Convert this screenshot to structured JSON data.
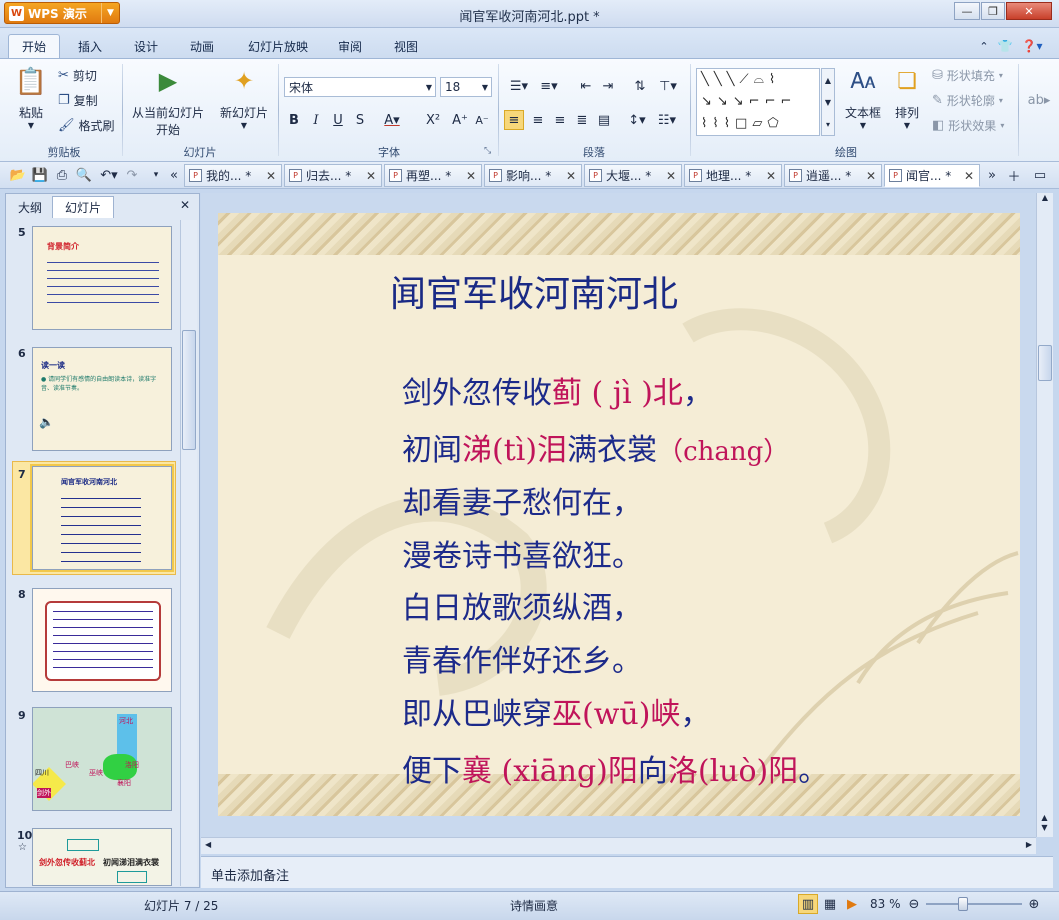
{
  "app": {
    "name": "WPS 演示"
  },
  "window": {
    "title": "闻官军收河南河北.ppt *"
  },
  "menu": {
    "tabs": [
      "开始",
      "插入",
      "设计",
      "动画",
      "幻灯片放映",
      "审阅",
      "视图"
    ]
  },
  "ribbon": {
    "clipboard": {
      "paste": "粘贴",
      "cut": "剪切",
      "copy": "复制",
      "format_painter": "格式刷",
      "label": "剪贴板"
    },
    "slides": {
      "from_current_line1": "从当前幻灯片",
      "from_current_line2": "开始",
      "new_slide": "新幻灯片",
      "label": "幻灯片"
    },
    "font": {
      "name": "宋体",
      "size": "18",
      "label": "字体"
    },
    "paragraph": {
      "label": "段落"
    },
    "drawing": {
      "textbox": "文本框",
      "arrange": "排列",
      "shape_fill": "形状填充",
      "shape_outline": "形状轮廓",
      "shape_effect": "形状效果",
      "label": "绘图"
    }
  },
  "doc_tabs": [
    "我的... *",
    "归去... *",
    "再塑... *",
    "影响... *",
    "大堰... *",
    "地理... *",
    "逍遥... *",
    "闻官... *"
  ],
  "left_panel": {
    "tab_outline": "大纲",
    "tab_slides": "幻灯片",
    "thumbs": [
      {
        "num": "5",
        "title": "背景简介"
      },
      {
        "num": "6",
        "title": "读一读",
        "text": "● 请同学们有感情的自由朗读本诗，读准字音、读准节奏。"
      },
      {
        "num": "7",
        "title": "闻官军收河南河北"
      },
      {
        "num": "8"
      },
      {
        "num": "9",
        "labels": [
          "河北",
          "四川",
          "剑外",
          "巴峡",
          "巫峡",
          "洛阳",
          "襄阳"
        ]
      },
      {
        "num": "10",
        "text1": "剑外忽传收蓟北",
        "text2": "初闻涕泪满衣裳"
      }
    ]
  },
  "slide": {
    "title": "闻官军收河南河北",
    "lines": [
      [
        {
          "t": "剑外忽传收"
        },
        {
          "t": "蓟 ( jì )北",
          "hl": true
        },
        {
          "t": "，"
        }
      ],
      [
        {
          "t": "初闻"
        },
        {
          "t": "涕(tì)泪",
          "hl": true
        },
        {
          "t": "满衣裳"
        },
        {
          "t": "（chang）",
          "hl": true
        }
      ],
      [
        {
          "t": "却看妻子愁何在，"
        }
      ],
      [
        {
          "t": "漫卷诗书喜欲狂。"
        }
      ],
      [
        {
          "t": "白日放歌须纵酒，"
        }
      ],
      [
        {
          "t": "青春作伴好还乡。"
        }
      ],
      [
        {
          "t": "即从巴峡穿"
        },
        {
          "t": "巫(wū)峡",
          "hl": true
        },
        {
          "t": "，"
        }
      ],
      [
        {
          "t": "便下"
        },
        {
          "t": "襄 (xiāng)阳",
          "hl": true
        },
        {
          "t": "向"
        },
        {
          "t": "洛(luò)阳",
          "hl": true
        },
        {
          "t": "。"
        }
      ]
    ]
  },
  "notes": {
    "placeholder": "单击添加备注"
  },
  "status": {
    "slide_counter": "幻灯片 7 / 25",
    "theme": "诗情画意",
    "zoom": "83 %"
  },
  "colors": {
    "title": "#1a2a85",
    "text": "#1c2a8a",
    "highlight": "#c0145a",
    "app_button": "#f5a623"
  }
}
